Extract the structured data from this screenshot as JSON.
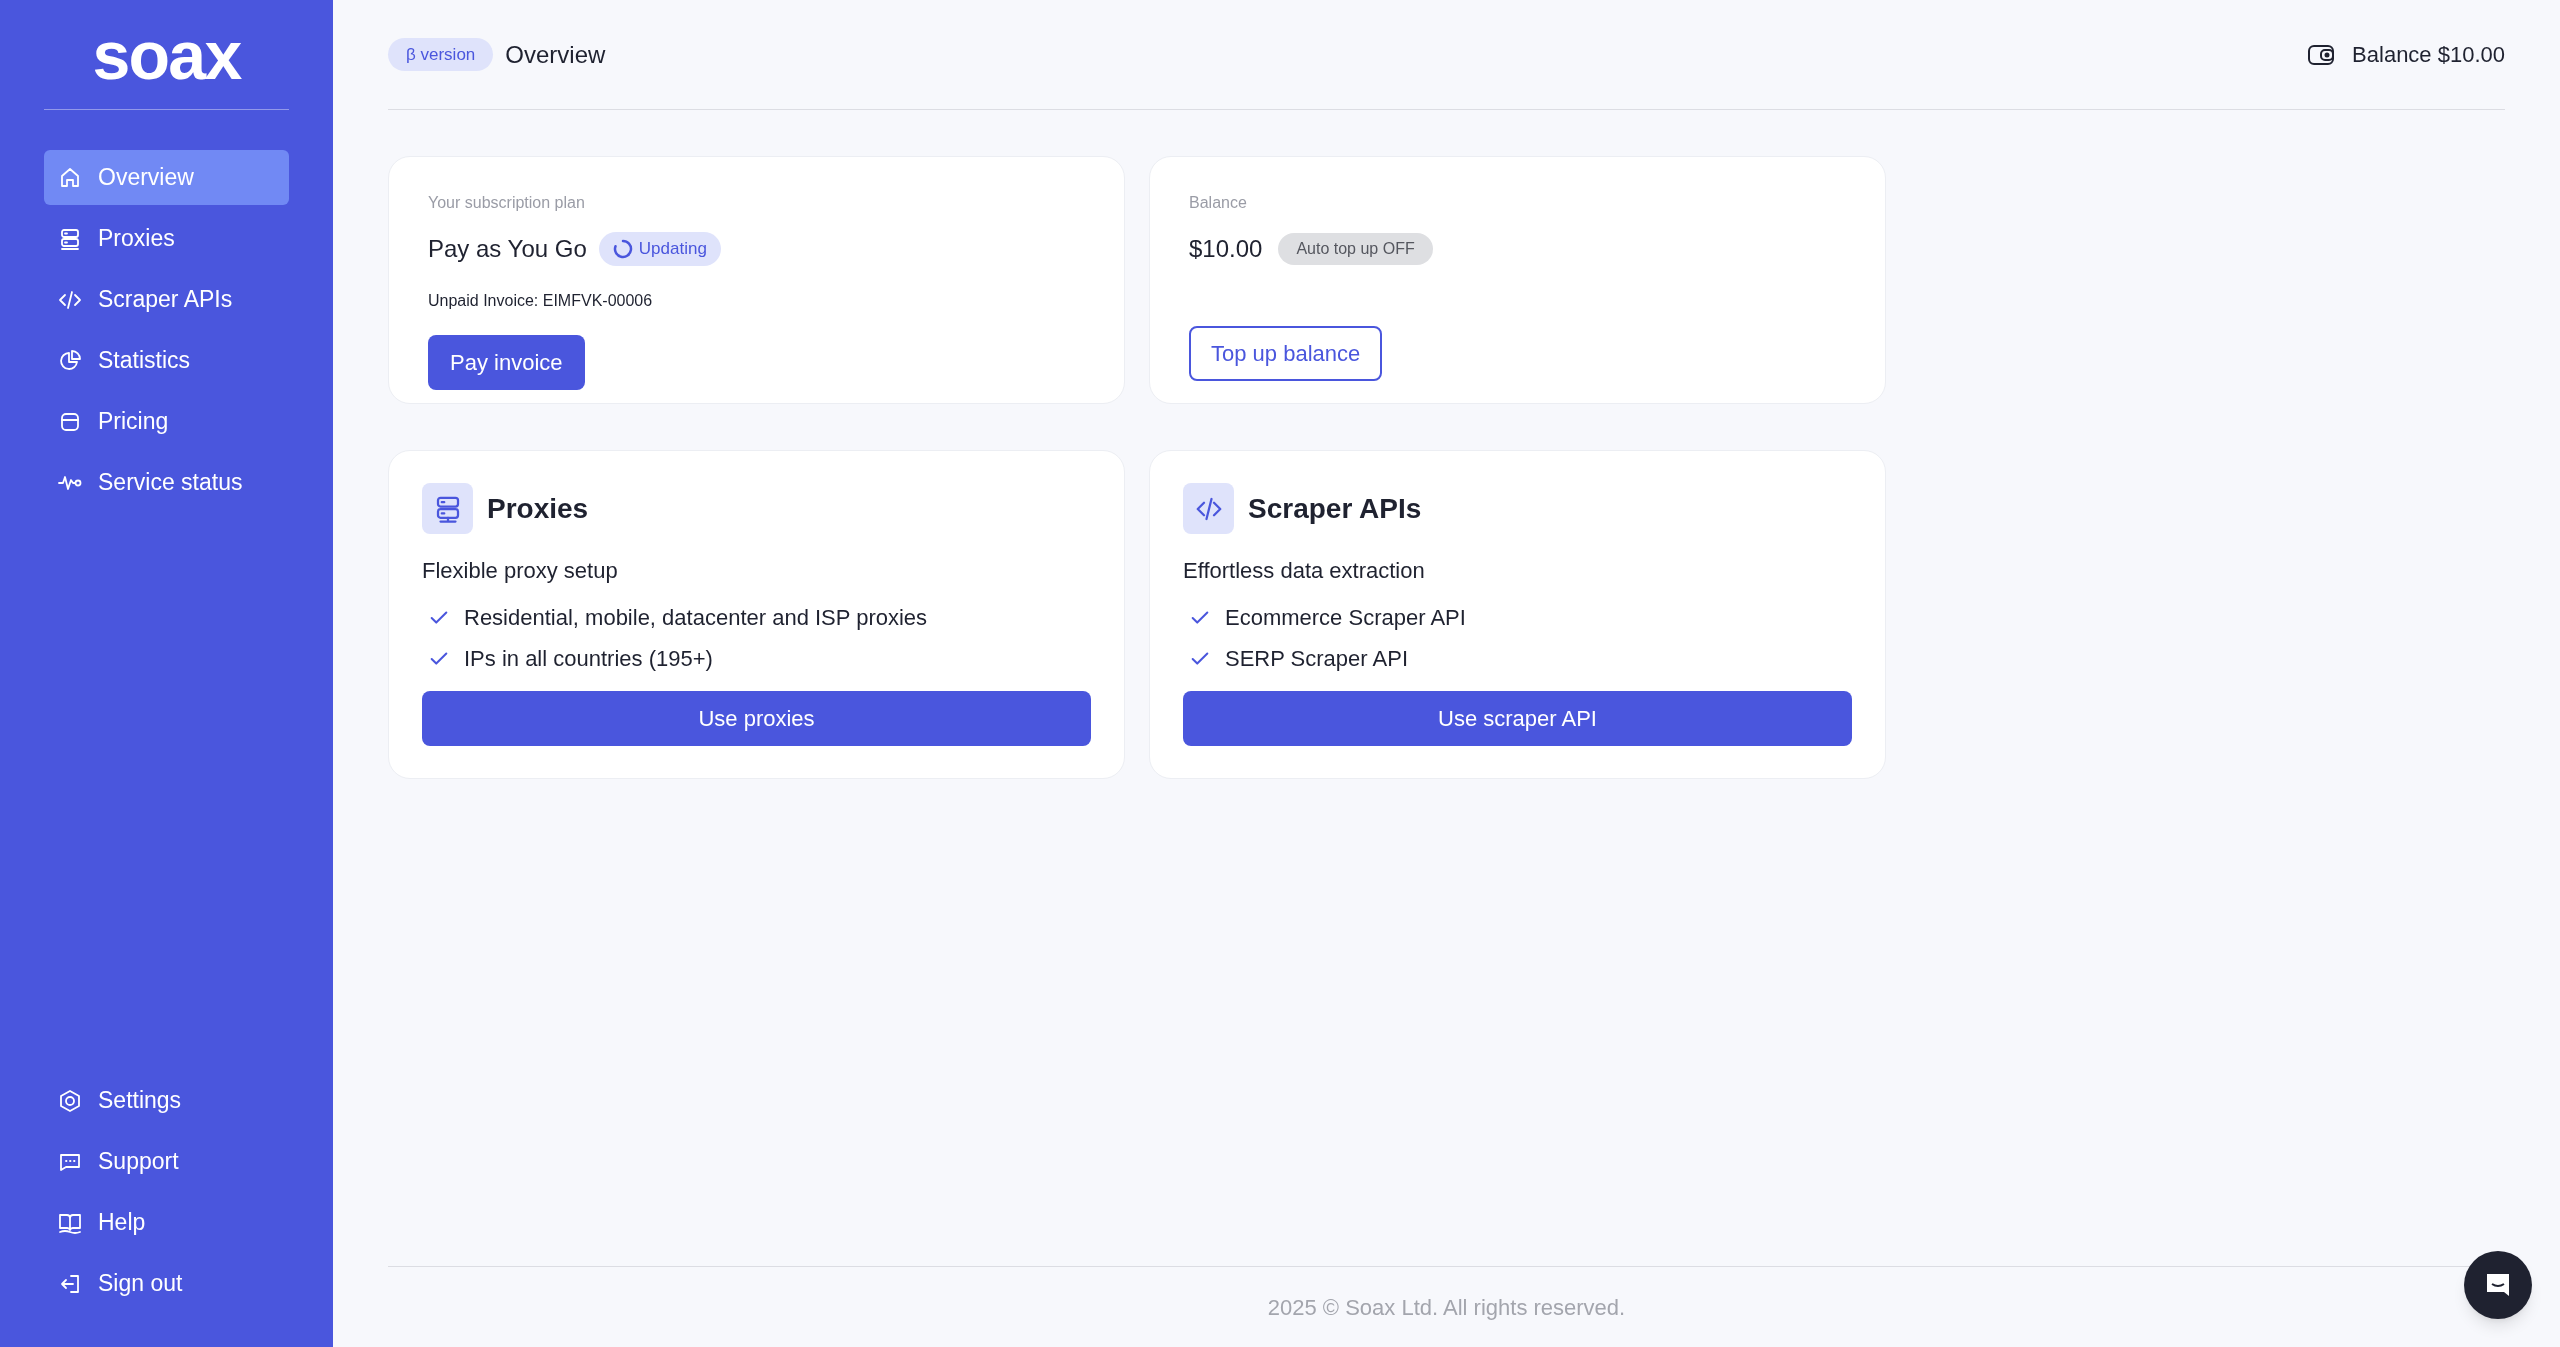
{
  "sidebar": {
    "logo": "soax",
    "nav": [
      {
        "label": "Overview",
        "selected": true
      },
      {
        "label": "Proxies",
        "selected": false
      },
      {
        "label": "Scraper APIs",
        "selected": false
      },
      {
        "label": "Statistics",
        "selected": false
      },
      {
        "label": "Pricing",
        "selected": false
      },
      {
        "label": "Service status",
        "selected": false
      }
    ],
    "bottom_nav": [
      {
        "label": "Settings",
        "selected": false
      },
      {
        "label": "Support",
        "selected": false
      },
      {
        "label": "Help",
        "selected": false
      },
      {
        "label": "Sign out",
        "selected": false
      }
    ]
  },
  "header": {
    "badge": "β version",
    "title": "Overview",
    "balance": "Balance $10.00"
  },
  "subscription_card": {
    "label": "Your subscription plan",
    "plan": "Pay as You Go",
    "status_badge": "Updating",
    "invoice": "Unpaid Invoice: EIMFVK-00006",
    "button": "Pay invoice"
  },
  "balance_card": {
    "label": "Balance",
    "amount": "$10.00",
    "auto_topup_badge": "Auto top up OFF",
    "button": "Top up balance"
  },
  "products": [
    {
      "title": "Proxies",
      "subtitle": "Flexible proxy setup",
      "features": [
        "Residential, mobile, datacenter and ISP proxies",
        "IPs in all countries (195+)"
      ],
      "button": "Use proxies"
    },
    {
      "title": "Scraper APIs",
      "subtitle": "Effortless data extraction",
      "features": [
        "Ecommerce Scraper API",
        "SERP Scraper API"
      ],
      "button": "Use scraper API"
    }
  ],
  "footer": "2025 © Soax Ltd. All rights reserved."
}
